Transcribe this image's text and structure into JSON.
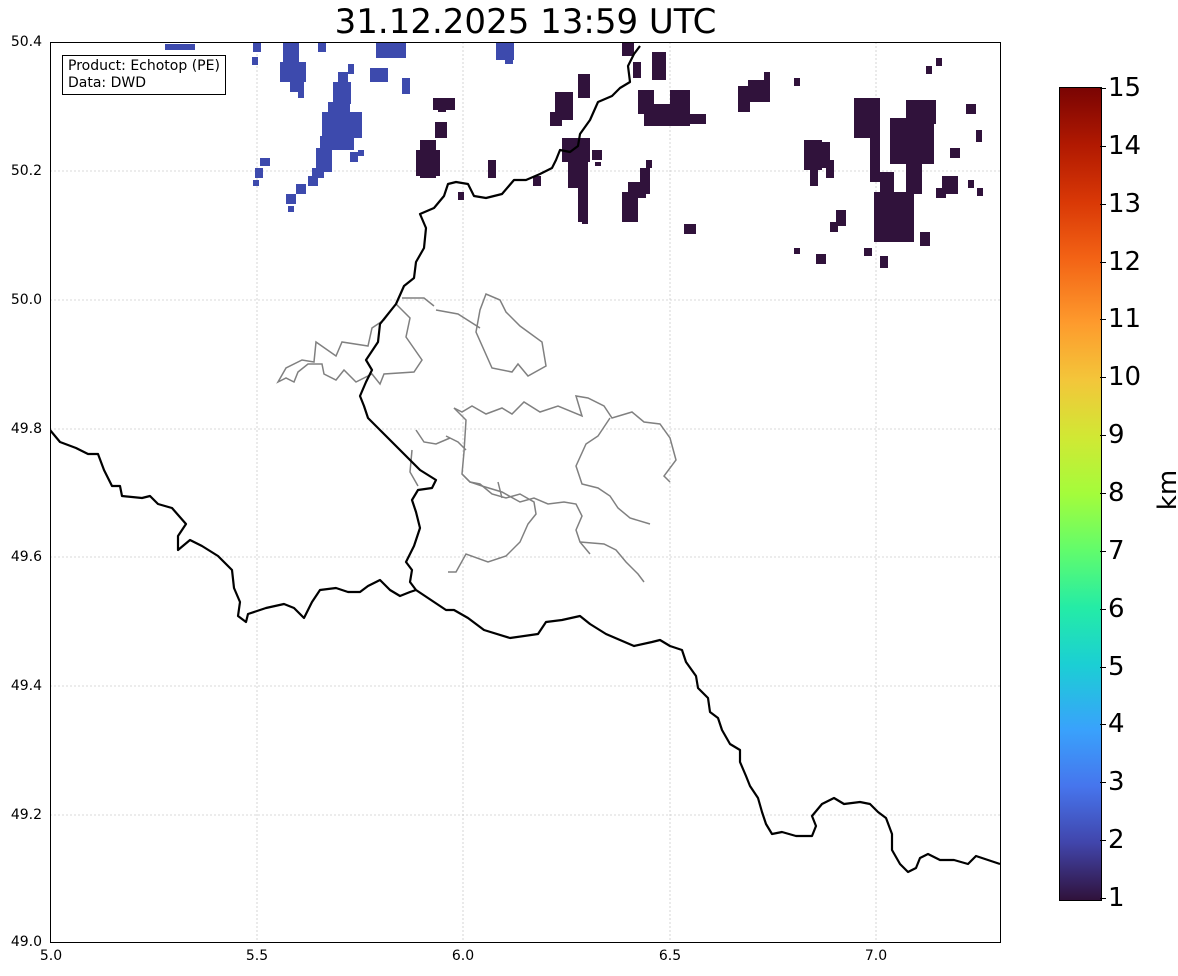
{
  "title": "31.12.2025 13:59 UTC",
  "info": {
    "product": "Product: Echotop (PE)",
    "source": "Data: DWD"
  },
  "axes": {
    "x_ticks": [
      "5.0",
      "5.5",
      "6.0",
      "6.5",
      "7.0"
    ],
    "y_ticks": [
      "50.4",
      "50.2",
      "50.0",
      "49.8",
      "49.6",
      "49.4",
      "49.2",
      "49.0"
    ],
    "xlim": [
      5.0,
      7.3
    ],
    "ylim": [
      49.0,
      50.4
    ],
    "grid": true
  },
  "colorbar": {
    "label": "km",
    "ticks": [
      "15",
      "14",
      "13",
      "12",
      "11",
      "10",
      "9",
      "8",
      "7",
      "6",
      "5",
      "4",
      "3",
      "2",
      "1"
    ],
    "range": [
      1,
      15
    ],
    "colormap": "turbo"
  },
  "colors": {
    "echo_low": "#30123b",
    "echo_mid": "#3d4aad",
    "border": "#000000",
    "admin": "#808080",
    "grid": "#cccccc"
  },
  "features": {
    "national_border": "national-border",
    "admin_borders": "canton-borders",
    "echo_cells": "radar-echotop-cells"
  }
}
